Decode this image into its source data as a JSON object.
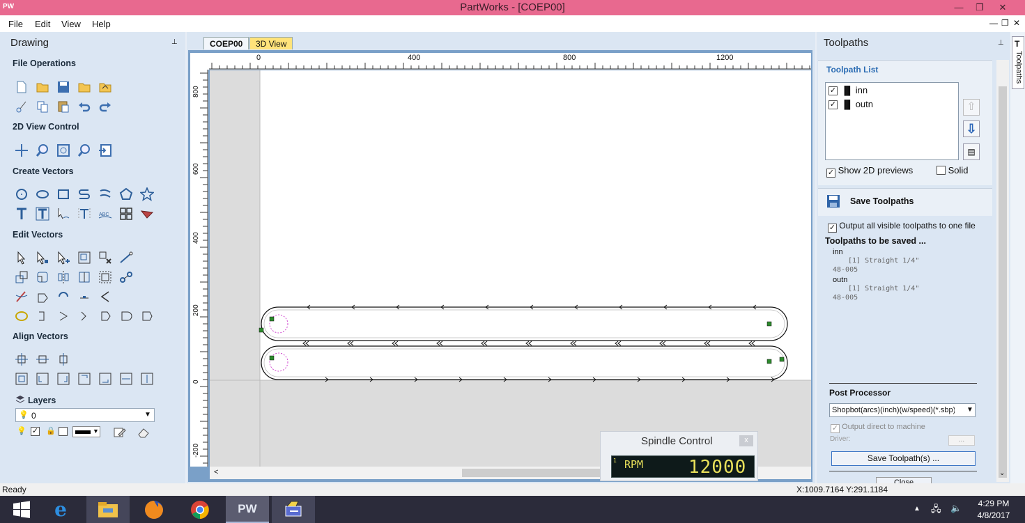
{
  "window": {
    "app_icon_text": "PW",
    "title": "PartWorks - [COEP00]",
    "min": "—",
    "restore": "❐",
    "close": "✕"
  },
  "menu": {
    "items": [
      "File",
      "Edit",
      "View",
      "Help"
    ]
  },
  "drawing_panel": {
    "title": "Drawing",
    "pin": "📌",
    "sections": {
      "file_ops": "File Operations",
      "view_ctrl": "2D View Control",
      "create": "Create Vectors",
      "edit": "Edit Vectors",
      "align": "Align Vectors"
    },
    "layers": {
      "title": "Layers",
      "selected": "0"
    }
  },
  "tabs": {
    "active": "COEP00",
    "other": "3D View"
  },
  "ruler": {
    "top_labels": [
      "0",
      "400",
      "800",
      "1200"
    ],
    "left_labels": [
      "800",
      "600",
      "400",
      "200",
      "0",
      "-200"
    ]
  },
  "spindle": {
    "title": "Spindle Control",
    "close": "x",
    "rpm_index": "1",
    "rpm_label": "RPM",
    "rpm_value": "12000"
  },
  "toolpaths_panel": {
    "title": "Toolpaths",
    "list_title": "Toolpath List",
    "items": [
      {
        "name": "inn",
        "checked": true
      },
      {
        "name": "outn",
        "checked": true
      }
    ],
    "show_2d": "Show 2D previews",
    "solid": "Solid",
    "save_title": "Save Toolpaths",
    "output_all": "Output all visible toolpaths to one file",
    "to_be_saved": "Toolpaths to be saved ...",
    "saved": [
      {
        "name": "inn",
        "detail": "[1] Straight 1/4\"",
        "code": "48-005"
      },
      {
        "name": "outn",
        "detail": "[1] Straight 1/4\"",
        "code": "48-005"
      }
    ],
    "post_processor_label": "Post Processor",
    "post_processor_value": "Shopbot(arcs)(inch)(w/speed)(*.sbp)",
    "output_direct": "Output direct to machine",
    "driver_label": "Driver:",
    "driver_btn": "...",
    "save_btn": "Save Toolpath(s) ...",
    "close_btn": "Close",
    "side_tab": "Toolpaths"
  },
  "status": {
    "left": "Ready",
    "coords": "X:1009.7164 Y:291.1184"
  },
  "taskbar": {
    "time": "4:29 PM",
    "date": "4/8/2017",
    "pw_label": "PW"
  }
}
